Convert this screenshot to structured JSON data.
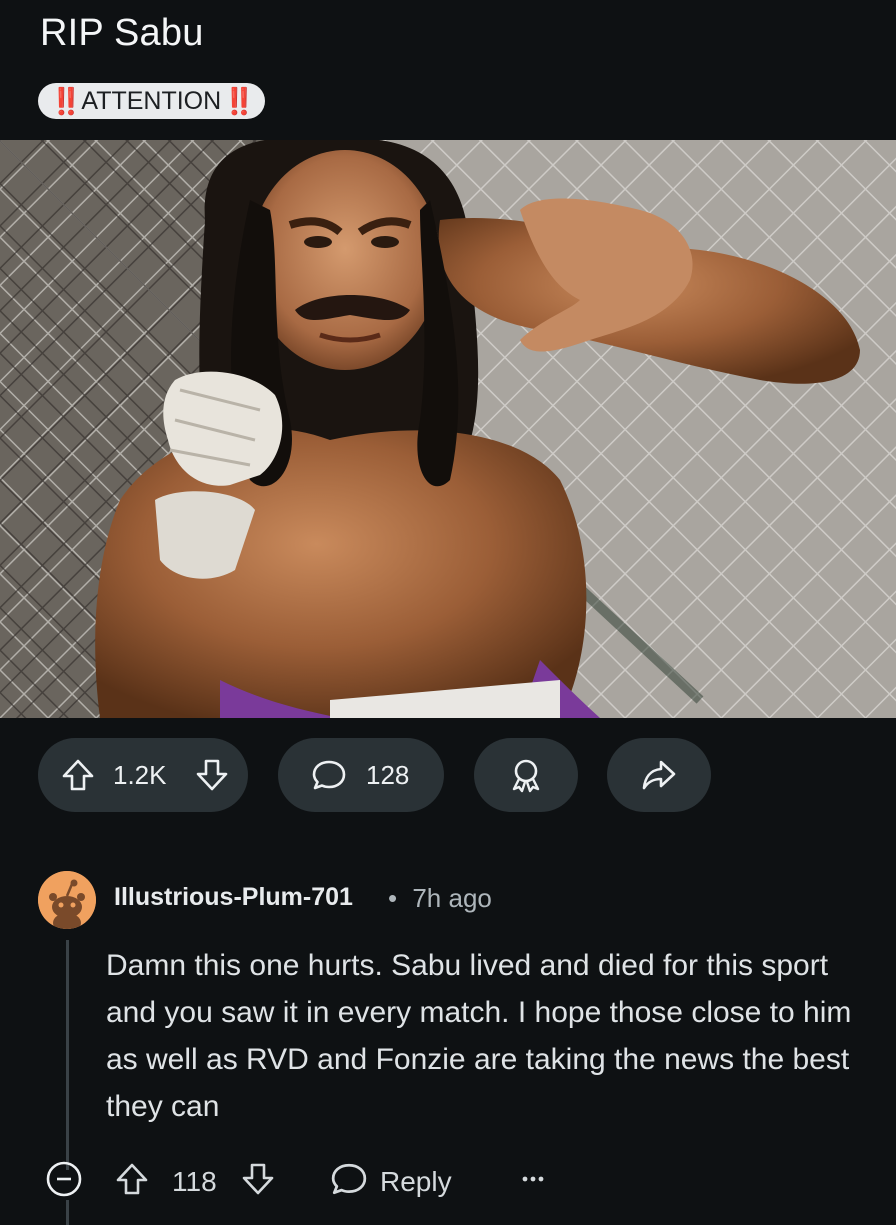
{
  "post": {
    "title": "RIP Sabu",
    "flair": {
      "prefix": "‼️",
      "text": "ATTENTION",
      "suffix": "‼️"
    },
    "image_alt": "Photo of wrestler Sabu in fighting stance in front of a chain-link fence",
    "actions": {
      "upvote_icon": "upvote-icon",
      "vote_count": "1.2K",
      "downvote_icon": "downvote-icon",
      "comment_icon": "comment-icon",
      "comment_count": "128",
      "award_icon": "award-icon",
      "share_icon": "share-icon"
    }
  },
  "comment": {
    "author": "Illustrious-Plum-701",
    "separator": "•",
    "time": "7h ago",
    "body": "Damn this one hurts. Sabu lived and died for this sport and you saw it in every match. I hope those close to him as well as RVD and Fonzie are taking the news the best they can",
    "actions": {
      "collapse_icon": "collapse-icon",
      "vote_count": "118",
      "reply_label": "Reply",
      "more_icon": "more-icon"
    }
  },
  "colors": {
    "background": "#0e1113",
    "pill": "#2a3236",
    "flair_bg": "#e9ebed",
    "flair_bang": "#e0271a",
    "avatar": "#f0a15f"
  }
}
